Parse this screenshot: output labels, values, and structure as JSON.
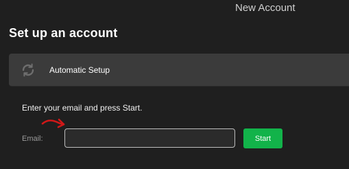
{
  "window": {
    "title": "New Account"
  },
  "page": {
    "title": "Set up an account"
  },
  "setup": {
    "label": "Automatic Setup",
    "icon": "sync-icon"
  },
  "form": {
    "instruction": "Enter your email and press Start.",
    "email_label": "Email:",
    "email_value": "",
    "email_placeholder": "",
    "start_label": "Start"
  },
  "annotation": {
    "icon": "red-arrow-icon",
    "color": "#d01818"
  },
  "colors": {
    "background": "#1f1f1f",
    "card": "#3b3b3b",
    "accent": "#12b34a"
  }
}
